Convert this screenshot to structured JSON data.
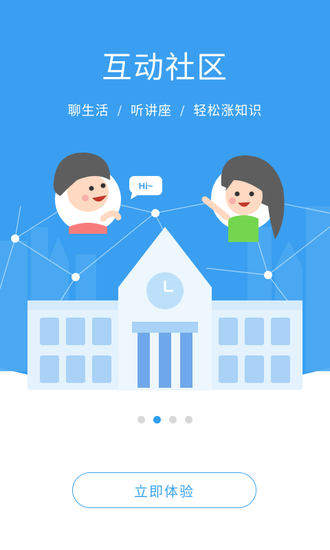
{
  "header": {
    "title": "互动社区",
    "subtitle": [
      "聊生活",
      "听讲座",
      "轻松涨知识"
    ],
    "separator": "/"
  },
  "illustration": {
    "bubble_text": "Hi~"
  },
  "pager": {
    "pages": 4,
    "active_index": 1
  },
  "cta": {
    "label": "立即体验"
  },
  "colors": {
    "hero_bg": "#3a9ff0",
    "accent": "#2d9df0",
    "cta_border": "#3aa3ee",
    "dot_inactive": "#d8d8d8"
  }
}
